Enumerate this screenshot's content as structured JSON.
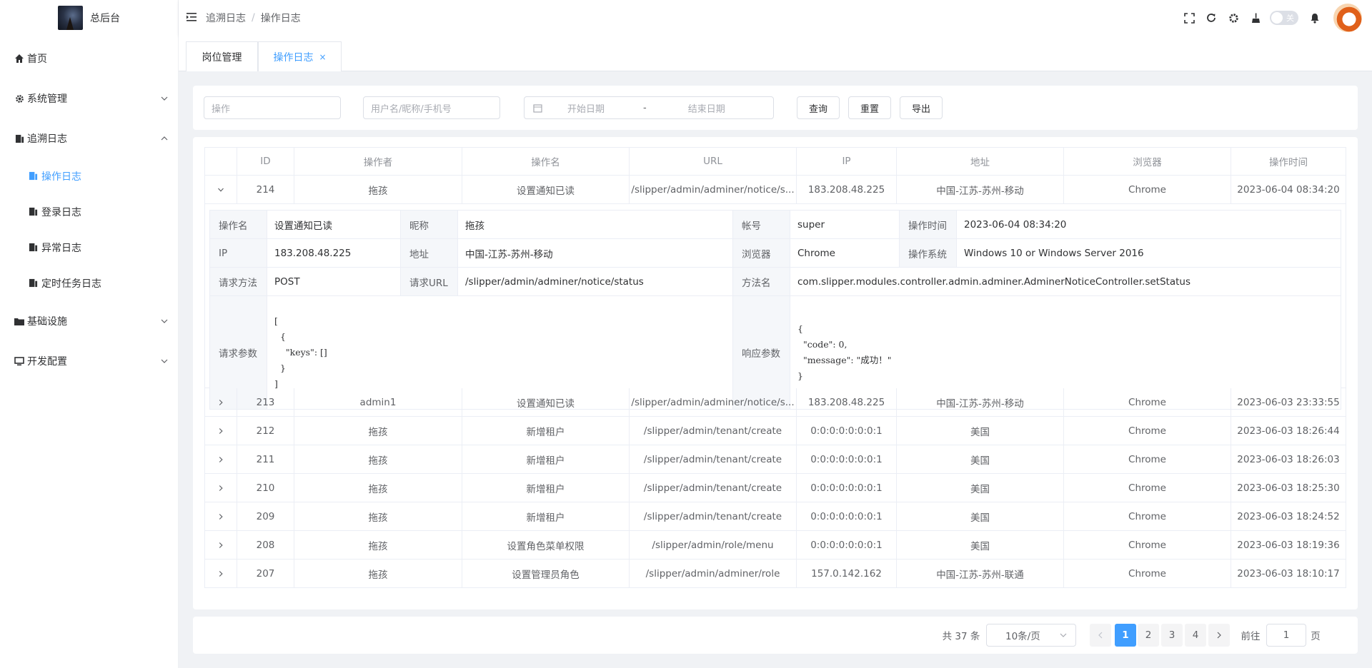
{
  "sidebar": {
    "logo_title": "总后台",
    "items": [
      {
        "label": "首页",
        "icon": "home-icon"
      },
      {
        "label": "系统管理",
        "icon": "gear-icon",
        "expanded": false
      },
      {
        "label": "追溯日志",
        "icon": "log-icon",
        "expanded": true
      },
      {
        "label": "基础设施",
        "icon": "folder-icon",
        "expanded": false
      },
      {
        "label": "开发配置",
        "icon": "monitor-icon",
        "expanded": false
      }
    ],
    "sub_items": [
      {
        "label": "操作日志",
        "active": true
      },
      {
        "label": "登录日志"
      },
      {
        "label": "异常日志"
      },
      {
        "label": "定时任务日志"
      }
    ]
  },
  "header": {
    "breadcrumb": [
      "追溯日志",
      "操作日志"
    ],
    "separator": "/",
    "toggle_label": "关"
  },
  "tabs": [
    {
      "label": "岗位管理",
      "active": false
    },
    {
      "label": "操作日志",
      "active": true,
      "close": "×"
    }
  ],
  "search": {
    "operation_placeholder": "操作",
    "user_placeholder": "用户名/昵称/手机号",
    "start_placeholder": "开始日期",
    "range_sep": "-",
    "end_placeholder": "结束日期",
    "query_label": "查询",
    "reset_label": "重置",
    "export_label": "导出"
  },
  "table": {
    "columns": [
      "",
      "ID",
      "操作者",
      "操作名",
      "URL",
      "IP",
      "地址",
      "浏览器",
      "操作时间"
    ],
    "expanded_row": {
      "id": "214",
      "operator": "拖孩",
      "name": "设置通知已读",
      "url": "/slipper/admin/adminer/notice/s...",
      "ip": "183.208.48.225",
      "address": "中国-江苏-苏州-移动",
      "browser": "Chrome",
      "time": "2023-06-04 08:34:20"
    },
    "rows": [
      {
        "id": "213",
        "operator": "admin1",
        "name": "设置通知已读",
        "url": "/slipper/admin/adminer/notice/s...",
        "ip": "183.208.48.225",
        "address": "中国-江苏-苏州-移动",
        "browser": "Chrome",
        "time": "2023-06-03 23:33:55"
      },
      {
        "id": "212",
        "operator": "拖孩",
        "name": "新增租户",
        "url": "/slipper/admin/tenant/create",
        "ip": "0:0:0:0:0:0:0:1",
        "address": "美国",
        "browser": "Chrome",
        "time": "2023-06-03 18:26:44"
      },
      {
        "id": "211",
        "operator": "拖孩",
        "name": "新增租户",
        "url": "/slipper/admin/tenant/create",
        "ip": "0:0:0:0:0:0:0:1",
        "address": "美国",
        "browser": "Chrome",
        "time": "2023-06-03 18:26:03"
      },
      {
        "id": "210",
        "operator": "拖孩",
        "name": "新增租户",
        "url": "/slipper/admin/tenant/create",
        "ip": "0:0:0:0:0:0:0:1",
        "address": "美国",
        "browser": "Chrome",
        "time": "2023-06-03 18:25:30"
      },
      {
        "id": "209",
        "operator": "拖孩",
        "name": "新增租户",
        "url": "/slipper/admin/tenant/create",
        "ip": "0:0:0:0:0:0:0:1",
        "address": "美国",
        "browser": "Chrome",
        "time": "2023-06-03 18:24:52"
      },
      {
        "id": "208",
        "operator": "拖孩",
        "name": "设置角色菜单权限",
        "url": "/slipper/admin/role/menu",
        "ip": "0:0:0:0:0:0:0:1",
        "address": "美国",
        "browser": "Chrome",
        "time": "2023-06-03 18:19:36"
      },
      {
        "id": "207",
        "operator": "拖孩",
        "name": "设置管理员角色",
        "url": "/slipper/admin/adminer/role",
        "ip": "157.0.142.162",
        "address": "中国-江苏-苏州-联通",
        "browser": "Chrome",
        "time": "2023-06-03 18:10:17"
      }
    ]
  },
  "detail": {
    "op_name_label": "操作名",
    "op_name": "设置通知已读",
    "nickname_label": "昵称",
    "nickname": "拖孩",
    "account_label": "帐号",
    "account": "super",
    "op_time_label": "操作时间",
    "op_time": "2023-06-04 08:34:20",
    "ip_label": "IP",
    "ip": "183.208.48.225",
    "address_label": "地址",
    "address": "中国-江苏-苏州-移动",
    "browser_label": "浏览器",
    "browser": "Chrome",
    "os_label": "操作系统",
    "os": "Windows 10 or Windows Server 2016",
    "method_label": "请求方法",
    "method": "POST",
    "req_url_label": "请求URL",
    "req_url": "/slipper/admin/adminer/notice/status",
    "func_label": "方法名",
    "func": "com.slipper.modules.controller.admin.adminer.AdminerNoticeController.setStatus",
    "req_params_label": "请求参数",
    "req_params": "[\n  {\n    \"keys\": []\n  }\n]",
    "resp_params_label": "响应参数",
    "resp_params": "{\n  \"code\": 0,\n  \"message\": \"成功！\"\n}"
  },
  "pagination": {
    "total": "共 37 条",
    "page_size": "10条/页",
    "pages": [
      "1",
      "2",
      "3",
      "4"
    ],
    "current": "1",
    "goto_label": "前往",
    "goto_value": "1",
    "page_suffix": "页"
  },
  "colors": {
    "accent": "#409eff"
  }
}
